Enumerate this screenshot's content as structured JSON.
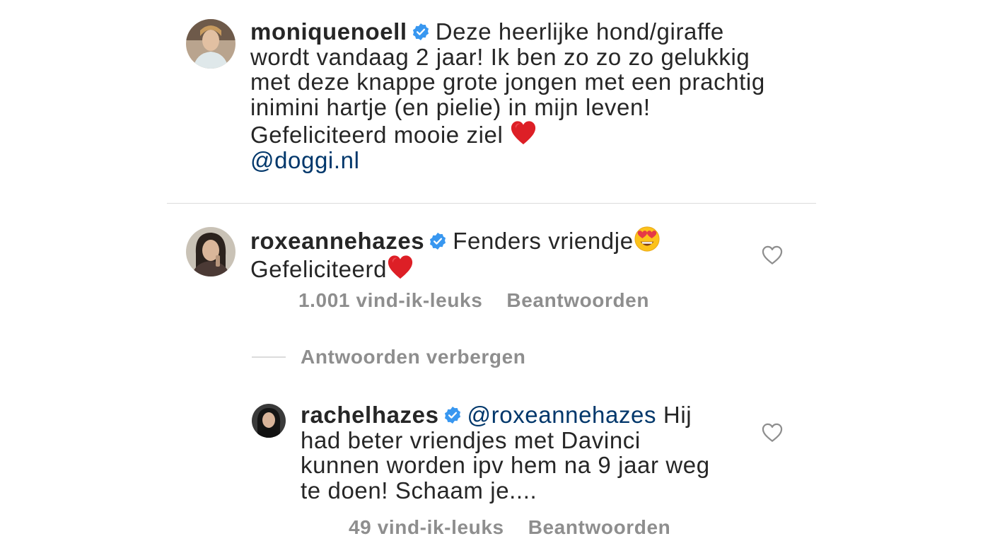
{
  "post_caption": {
    "username": "moniquenoell",
    "verified": true,
    "text": "Deze heerlijke hond/giraffe wordt vandaag 2 jaar! Ik ben zo zo zo gelukkig met deze knappe grote jongen met een prachtig inimini hartje (en pielie) in mijn leven! Gefeliciteerd mooie ziel",
    "emoji": "red-heart",
    "mention": "@doggi.nl"
  },
  "comments": [
    {
      "username": "roxeannehazes",
      "verified": true,
      "text_part1": "Fenders vriendje",
      "emoji1": "heart-eyes-face",
      "text_part2": "Gefeliciteerd",
      "emoji2": "red-heart",
      "likes": "1.001 vind-ik-leuks",
      "reply_label": "Beantwoorden",
      "hide_replies_label": "Antwoorden verbergen",
      "replies": [
        {
          "username": "rachelhazes",
          "verified": true,
          "mention": "@roxeannehazes",
          "text": "Hij had beter vriendjes met Davinci kunnen worden ipv hem na 9 jaar weg te doen! Schaam je....",
          "likes": "49 vind-ik-leuks",
          "reply_label": "Beantwoorden"
        }
      ]
    }
  ],
  "colors": {
    "text": "#262626",
    "secondary": "#8e8e8e",
    "mention": "#00376b",
    "verified_badge": "#3897f0",
    "divider": "#dbdbdb"
  }
}
